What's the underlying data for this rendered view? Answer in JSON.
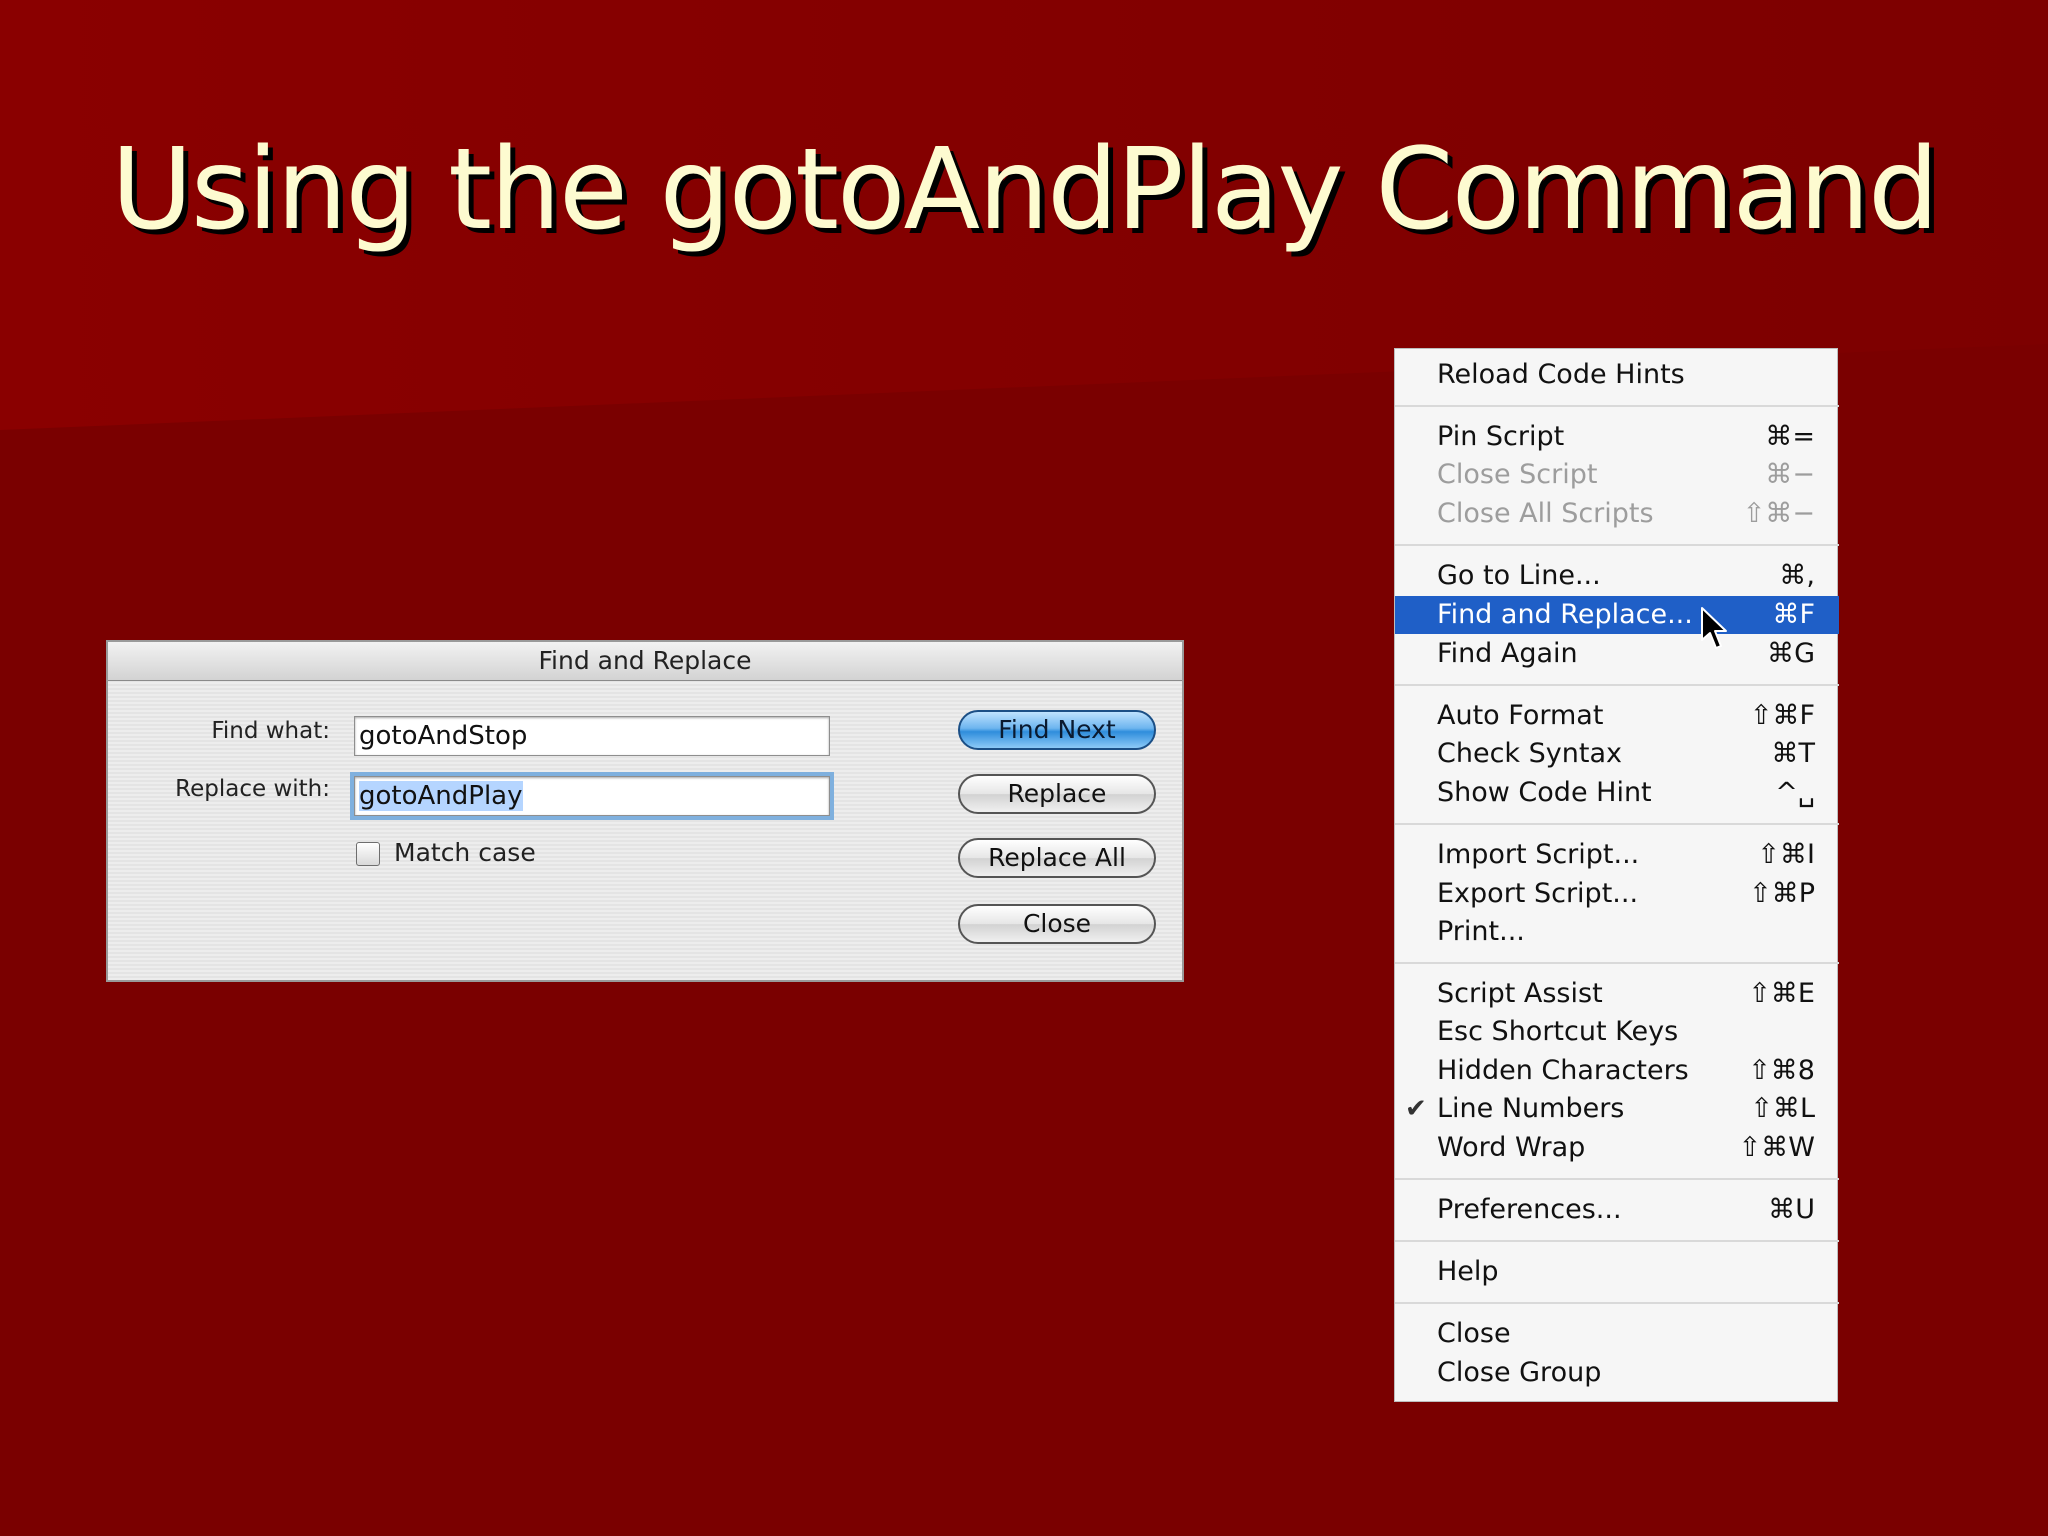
{
  "slide": {
    "title": "Using the gotoAndPlay Command"
  },
  "dialog": {
    "title": "Find and Replace",
    "find_label": "Find what:",
    "find_value": "gotoAndStop",
    "replace_label": "Replace with:",
    "replace_value": "gotoAndPlay",
    "match_case_label": "Match case",
    "match_case_checked": false,
    "buttons": {
      "find_next": "Find Next",
      "replace": "Replace",
      "replace_all": "Replace All",
      "close": "Close"
    }
  },
  "menu": {
    "items": [
      {
        "label": "Reload Code Hints",
        "shortcut": ""
      },
      {
        "label": "Pin Script",
        "shortcut": "⌘="
      },
      {
        "label": "Close Script",
        "shortcut": "⌘−",
        "disabled": true
      },
      {
        "label": "Close All Scripts",
        "shortcut": "⇧⌘−",
        "disabled": true
      },
      {
        "label": "Go to Line...",
        "shortcut": "⌘,"
      },
      {
        "label": "Find and Replace...",
        "shortcut": "⌘F",
        "highlighted": true
      },
      {
        "label": "Find Again",
        "shortcut": "⌘G"
      },
      {
        "label": "Auto Format",
        "shortcut": "⇧⌘F"
      },
      {
        "label": "Check Syntax",
        "shortcut": "⌘T"
      },
      {
        "label": "Show Code Hint",
        "shortcut": "^␣"
      },
      {
        "label": "Import Script...",
        "shortcut": "⇧⌘I"
      },
      {
        "label": "Export Script...",
        "shortcut": "⇧⌘P"
      },
      {
        "label": "Print...",
        "shortcut": ""
      },
      {
        "label": "Script Assist",
        "shortcut": "⇧⌘E"
      },
      {
        "label": "Esc Shortcut Keys",
        "shortcut": ""
      },
      {
        "label": "Hidden Characters",
        "shortcut": "⇧⌘8"
      },
      {
        "label": "Line Numbers",
        "shortcut": "⇧⌘L",
        "checked": true
      },
      {
        "label": "Word Wrap",
        "shortcut": "⇧⌘W"
      },
      {
        "label": "Preferences...",
        "shortcut": "⌘U"
      },
      {
        "label": "Help",
        "shortcut": ""
      },
      {
        "label": "Close",
        "shortcut": ""
      },
      {
        "label": "Close Group",
        "shortcut": ""
      }
    ],
    "check_mark": "✔"
  }
}
